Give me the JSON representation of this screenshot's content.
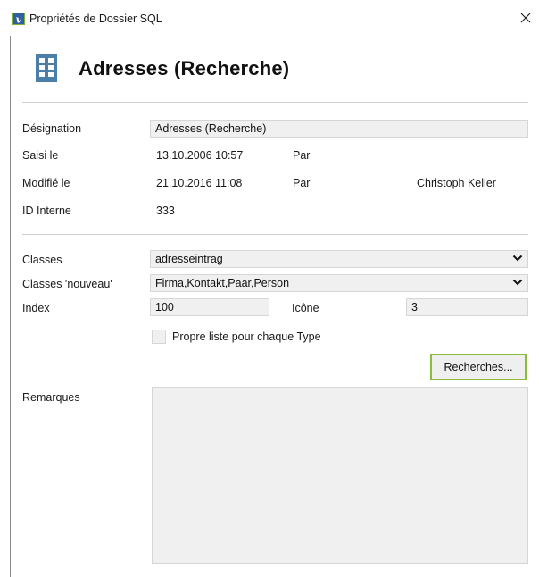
{
  "window": {
    "title": "Propriétés de Dossier SQL",
    "close_glyph": "✕"
  },
  "header": {
    "title": "Adresses (Recherche)",
    "icon": "building-icon",
    "icon_color": "#4a7fa8"
  },
  "info": {
    "designation_label": "Désignation",
    "designation_value": "Adresses (Recherche)",
    "saisi_label": "Saisi le",
    "saisi_value": "13.10.2006 10:57",
    "saisi_par_label": "Par",
    "modifie_label": "Modifié le",
    "modifie_value": "21.10.2016 11:08",
    "modifie_par_label": "Par",
    "modifie_par_value": "Christoph Keller",
    "id_label": "ID Interne",
    "id_value": "333"
  },
  "settings": {
    "classes_label": "Classes",
    "classes_value": "adresseintrag",
    "classes_nouveau_label": "Classes 'nouveau'",
    "classes_nouveau_value": "Firma,Kontakt,Paar,Person",
    "index_label": "Index",
    "index_value": "100",
    "icone_label": "Icône",
    "icone_value": "3",
    "checkbox_label": "Propre liste pour chaque Type",
    "checkbox_checked": false,
    "recherches_button": "Recherches...",
    "accent_color": "#8dbb3c"
  },
  "remarks": {
    "label": "Remarques",
    "value": ""
  }
}
